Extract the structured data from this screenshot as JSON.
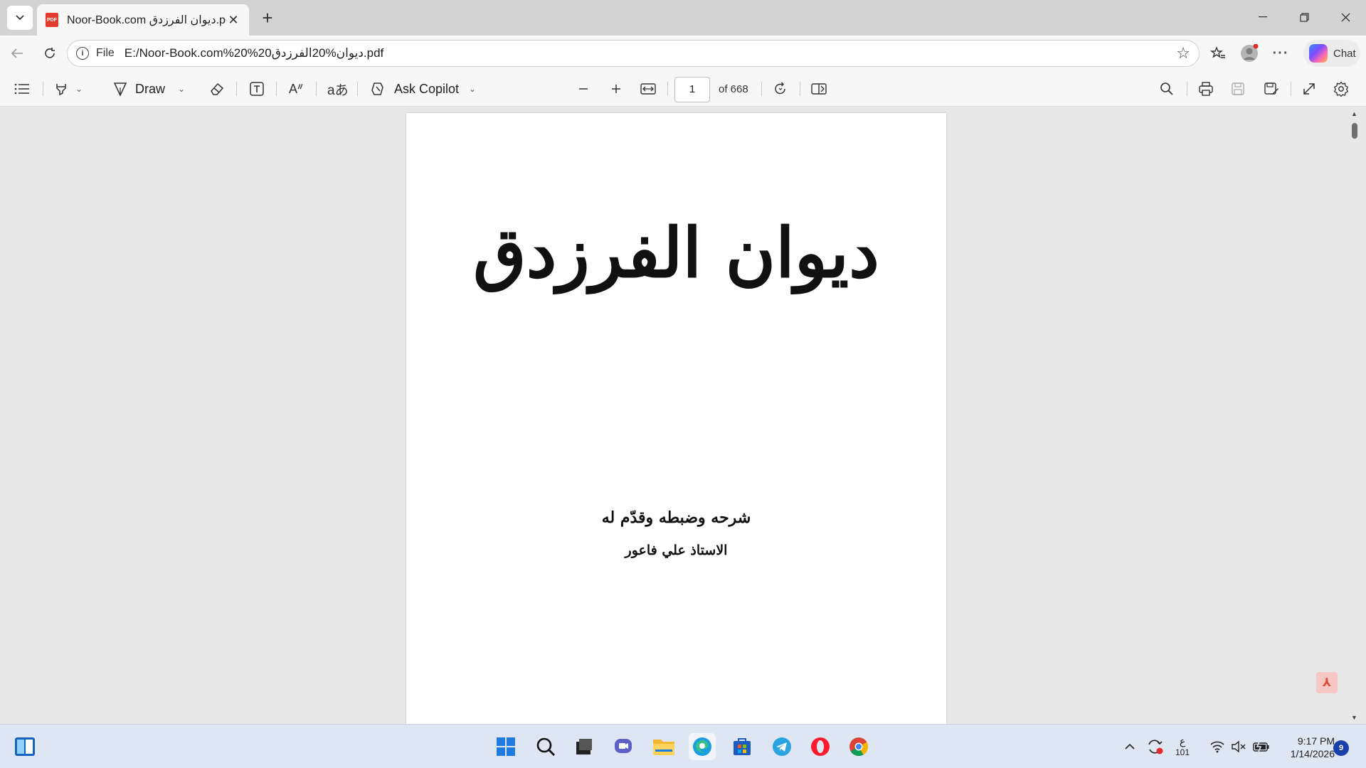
{
  "browser": {
    "tab_title": "Noor-Book.com ديوان الفرزدق.pdf",
    "url_scheme": "File",
    "url": "E:/Noor-Book.com%20%20ديوان%20الفرزدق.pdf",
    "chat_label": "Chat"
  },
  "pdf_toolbar": {
    "draw_label": "Draw",
    "ask_copilot_label": "Ask Copilot",
    "current_page": "1",
    "total_pages": "of 668"
  },
  "document": {
    "title": "ديوان الفرزدق",
    "subtitle_line1": "شرحه وضبطه وقدّم له",
    "subtitle_line2": "الاستاذ علي فاعور"
  },
  "taskbar": {
    "ime_indicator": "ع",
    "ime_sub": "101",
    "time": "9:17 PM",
    "date": "1/14/2026",
    "notification_count": "9"
  }
}
